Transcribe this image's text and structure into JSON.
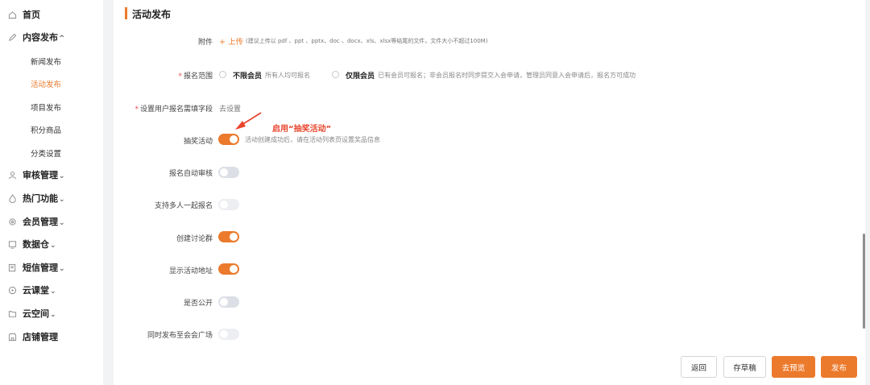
{
  "sidebar": {
    "items": [
      {
        "label": "首页",
        "icon": "home-icon",
        "chevron": ""
      },
      {
        "label": "内容发布",
        "icon": "edit-icon",
        "chevron": "^"
      },
      {
        "label": "审核管理",
        "icon": "user-icon",
        "chevron": "⌄"
      },
      {
        "label": "热门功能",
        "icon": "fire-icon",
        "chevron": "⌄"
      },
      {
        "label": "会员管理",
        "icon": "settings-icon",
        "chevron": "⌄"
      },
      {
        "label": "数据仓",
        "icon": "monitor-icon",
        "chevron": "⌄"
      },
      {
        "label": "短信管理",
        "icon": "message-icon",
        "chevron": "⌄"
      },
      {
        "label": "云课堂",
        "icon": "circle-icon",
        "chevron": "⌄"
      },
      {
        "label": "云空间",
        "icon": "folder-icon",
        "chevron": "⌄"
      },
      {
        "label": "店铺管理",
        "icon": "shop-icon",
        "chevron": ""
      }
    ],
    "sub_items": [
      {
        "label": "新闻发布",
        "active": false
      },
      {
        "label": "活动发布",
        "active": true
      },
      {
        "label": "项目发布",
        "active": false
      },
      {
        "label": "积分商品",
        "active": false
      },
      {
        "label": "分类设置",
        "active": false
      }
    ]
  },
  "page": {
    "title": "活动发布"
  },
  "form": {
    "attachment": {
      "label": "附件",
      "upload_label": "+ 上传",
      "hint": "(建议上传以 pdf 、ppt 、pptx、doc 、docx、xls、xlsx等结尾的文件，文件大小不超过100M)"
    },
    "scope": {
      "required": "*",
      "label": "报名范围",
      "options": [
        {
          "label": "不限会员",
          "desc": "所有人均可报名"
        },
        {
          "label": "仅限会员",
          "desc": "已有会员可报名；非会员报名时同步提交入会申请，管理员同意入会申请后，报名方可成功"
        }
      ]
    },
    "fields": {
      "required": "*",
      "label": "设置用户报名需填字段",
      "link": "去设置"
    },
    "toggles": [
      {
        "label": "抽奖活动",
        "state": "on"
      },
      {
        "label": "报名自动审核",
        "state": "off"
      },
      {
        "label": "支持多人一起报名",
        "state": "faint"
      },
      {
        "label": "创建讨论群",
        "state": "on"
      },
      {
        "label": "显示活动地址",
        "state": "on"
      },
      {
        "label": "是否公开",
        "state": "off"
      },
      {
        "label": "同时发布至会会广场",
        "state": "faint"
      }
    ],
    "lottery_hint": "活动创建成功后，请在活动列表页设置奖品信息"
  },
  "annotation": {
    "text": "启用“抽奖活动”",
    "color": "#e8452c"
  },
  "actions": {
    "back": "返回",
    "draft": "存草稿",
    "preview": "去预览",
    "publish": "发布"
  },
  "colors": {
    "accent": "#ec7a2c"
  }
}
